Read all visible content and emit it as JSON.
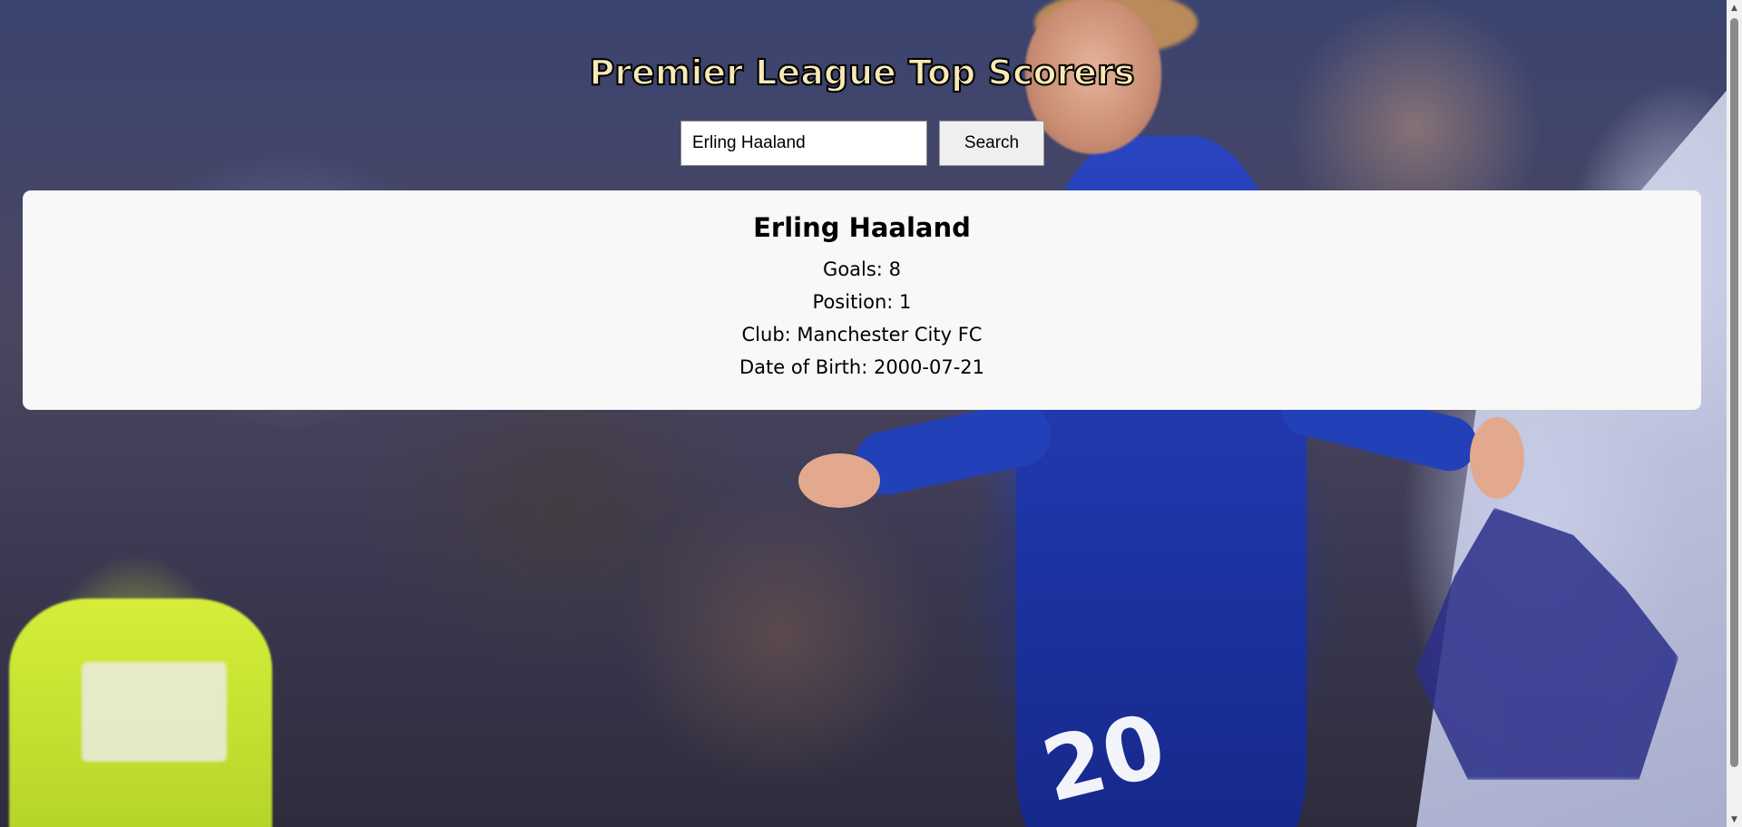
{
  "page": {
    "title": "Premier League Top Scorers"
  },
  "search": {
    "value": "Erling Haaland",
    "button_label": "Search"
  },
  "result": {
    "name": "Erling Haaland",
    "goals": "Goals: 8",
    "position": "Position: 1",
    "club": "Club: Manchester City FC",
    "dob": "Date of Birth: 2000-07-21"
  },
  "background": {
    "shirt_number": "20"
  },
  "scrollbar": {
    "up_icon": "chevron-up-icon",
    "down_icon": "chevron-down-icon"
  }
}
